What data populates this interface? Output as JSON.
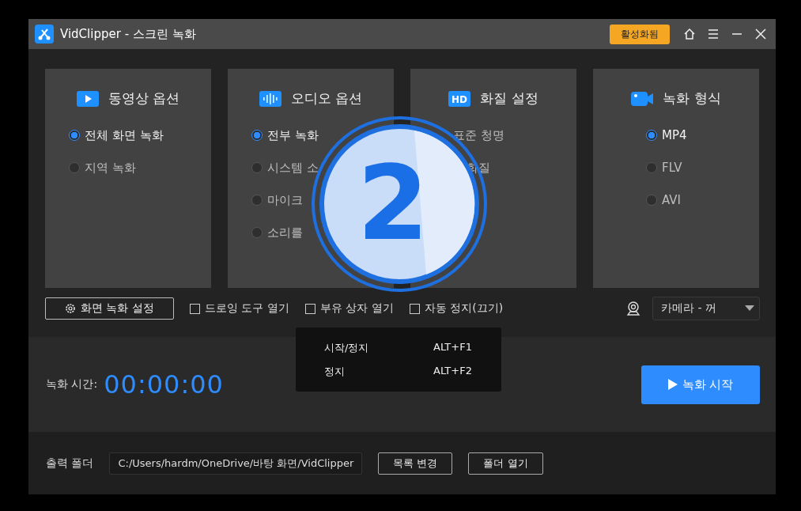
{
  "window": {
    "title": "VidClipper - 스크린 녹화",
    "activate_button": "활성화됨"
  },
  "panels": [
    {
      "title": "동영상 옵션",
      "options": [
        {
          "label": "전체 화면 녹화",
          "selected": true
        },
        {
          "label": "지역 녹화",
          "selected": false
        }
      ]
    },
    {
      "title": "오디오 옵션",
      "options": [
        {
          "label": "전부 녹화",
          "selected": true
        },
        {
          "label": "시스템 소",
          "selected": false
        },
        {
          "label": "마이크",
          "selected": false
        },
        {
          "label": "소리를",
          "selected": false
        }
      ]
    },
    {
      "title": "화질 설정",
      "icon_text": "HD",
      "options": [
        {
          "label": "표준 청명"
        },
        {
          "label": "화질"
        }
      ]
    },
    {
      "title": "녹화 형식",
      "options": [
        {
          "label": "MP4",
          "selected": true
        },
        {
          "label": "FLV",
          "selected": false
        },
        {
          "label": "AVI",
          "selected": false
        }
      ]
    }
  ],
  "step_badge": "2",
  "toolbar": {
    "settings_button": "화면 녹화 설정",
    "checkboxes": [
      {
        "label": "드로잉 도구 열기",
        "checked": false
      },
      {
        "label": "부유 상자 열기",
        "checked": false
      },
      {
        "label": "자동 정지(끄기)",
        "checked": false
      }
    ],
    "camera_select": "카메라 - 꺼"
  },
  "hotkeys": [
    {
      "action": "시작/정지",
      "keys": "ALT+F1"
    },
    {
      "action": "정지",
      "keys": "ALT+F2"
    }
  ],
  "record": {
    "time_label": "녹화 시간:",
    "time": "00:00:00",
    "start_button": "녹화 시작"
  },
  "output": {
    "label": "출력 폴더",
    "path": "C:/Users/hardm/OneDrive/바탕 화면/VidClipper",
    "change_button": "목록 변경",
    "open_button": "폴더 열기"
  }
}
